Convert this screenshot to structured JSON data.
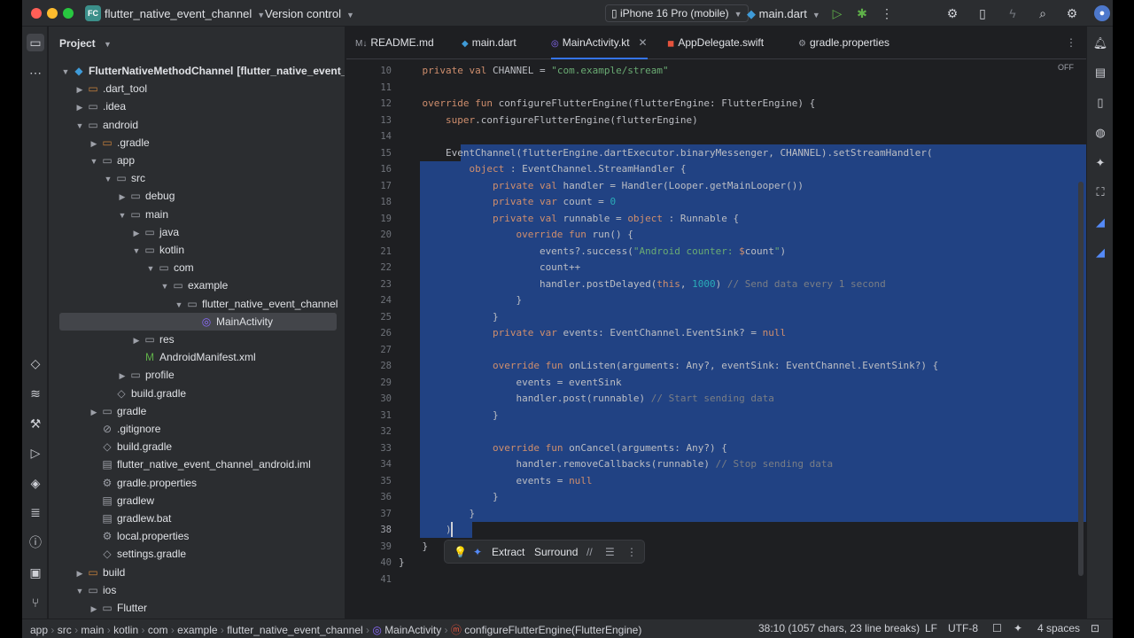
{
  "titlebar": {
    "project_badge": "FC",
    "project_name": "flutter_native_event_channel",
    "vcs": "Version control",
    "device": "iPhone 16 Pro (mobile)",
    "run_config": "main.dart"
  },
  "project_panel": {
    "title": "Project",
    "rows": [
      {
        "label": "FlutterNativeMethodChannel",
        "extra": "[flutter_native_event_chan"
      },
      {
        "label": ".dart_tool"
      },
      {
        "label": ".idea"
      },
      {
        "label": "android"
      },
      {
        "label": ".gradle"
      },
      {
        "label": "app"
      },
      {
        "label": "src"
      },
      {
        "label": "debug"
      },
      {
        "label": "main"
      },
      {
        "label": "java"
      },
      {
        "label": "kotlin"
      },
      {
        "label": "com"
      },
      {
        "label": "example"
      },
      {
        "label": "flutter_native_event_channel"
      },
      {
        "label": "MainActivity"
      },
      {
        "label": "res"
      },
      {
        "label": "AndroidManifest.xml"
      },
      {
        "label": "profile"
      },
      {
        "label": "build.gradle"
      },
      {
        "label": "gradle"
      },
      {
        "label": ".gitignore"
      },
      {
        "label": "build.gradle"
      },
      {
        "label": "flutter_native_event_channel_android.iml"
      },
      {
        "label": "gradle.properties"
      },
      {
        "label": "gradlew"
      },
      {
        "label": "gradlew.bat"
      },
      {
        "label": "local.properties"
      },
      {
        "label": "settings.gradle"
      },
      {
        "label": "build"
      },
      {
        "label": "ios"
      },
      {
        "label": "Flutter"
      }
    ]
  },
  "tabs": [
    {
      "label": "README.md",
      "icon": "M↓"
    },
    {
      "label": "main.dart",
      "icon": "dart-icon"
    },
    {
      "label": "MainActivity.kt",
      "icon": "kotlin-icon"
    },
    {
      "label": "AppDelegate.swift",
      "icon": "swift-icon"
    },
    {
      "label": "gradle.properties",
      "icon": "gear-icon"
    }
  ],
  "editor": {
    "off_label": "OFF",
    "line_numbers": [
      "10",
      "11",
      "12",
      "13",
      "14",
      "15",
      "16",
      "17",
      "18",
      "19",
      "20",
      "21",
      "22",
      "23",
      "24",
      "25",
      "26",
      "27",
      "28",
      "29",
      "30",
      "31",
      "32",
      "33",
      "34",
      "35",
      "36",
      "37",
      "38",
      "39",
      "40",
      "41"
    ]
  },
  "popup": {
    "extract": "Extract",
    "surround": "Surround"
  },
  "statusbar": {
    "breadcrumbs": [
      "app",
      "src",
      "main",
      "kotlin",
      "com",
      "example",
      "flutter_native_event_channel",
      "MainActivity",
      "configureFlutterEngine(FlutterEngine)"
    ],
    "position": "38:10 (1057 chars, 23 line breaks)",
    "line_ending": "LF",
    "encoding": "UTF-8",
    "indent": "4 spaces"
  }
}
